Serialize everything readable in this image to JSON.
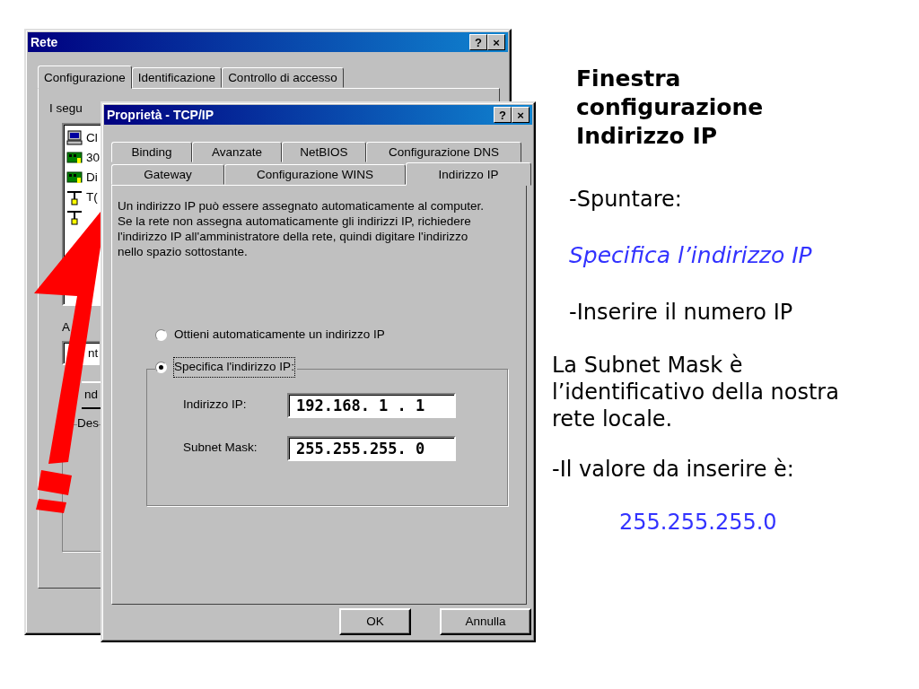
{
  "network_window": {
    "title": "Rete",
    "title_buttons": [
      "?",
      "×"
    ],
    "tabs": [
      {
        "label": "Configurazione",
        "selected": true
      },
      {
        "label": "Identificazione",
        "selected": false
      },
      {
        "label": "Controllo di accesso",
        "selected": false
      }
    ],
    "list_label": "I segu",
    "components": [
      {
        "kind": "client",
        "text": "Cl"
      },
      {
        "kind": "adapter",
        "text": "30"
      },
      {
        "kind": "adapter",
        "text": "Di"
      },
      {
        "kind": "protocol",
        "text": "T("
      },
      {
        "kind": "protocol"
      }
    ],
    "primary_label": "A",
    "primary_field": "nt",
    "button": "nd",
    "description_label": "Des"
  },
  "tcpip_window": {
    "title": "Proprietà - TCP/IP",
    "title_buttons": [
      "?",
      "×"
    ],
    "tab_rows": [
      [
        {
          "label": "Binding",
          "selected": false
        },
        {
          "label": "Avanzate",
          "selected": false
        },
        {
          "label": "NetBIOS",
          "selected": false
        },
        {
          "label": "Configurazione DNS",
          "selected": false
        }
      ],
      [
        {
          "label": "Gateway",
          "selected": false
        },
        {
          "label": "Configurazione WINS",
          "selected": false
        },
        {
          "label": "Indirizzo IP",
          "selected": true
        }
      ]
    ],
    "description": "Un indirizzo IP può essere assegnato automaticamente al computer. Se la rete non assegna automaticamente gli indirizzi IP, richiedere l'indirizzo IP all'amministratore della rete, quindi digitare l'indirizzo nello spazio sottostante.",
    "radios": [
      {
        "label": "Ottieni automaticamente un indirizzo IP",
        "selected": false
      },
      {
        "label": "Specifica l'indirizzo IP:",
        "selected": true
      }
    ],
    "fields": [
      {
        "label": "Indirizzo IP:",
        "value": "192.168. 1 . 1"
      },
      {
        "label": "Subnet Mask:",
        "value": "255.255.255. 0"
      }
    ],
    "buttons": [
      "OK",
      "Annulla"
    ]
  },
  "slide": {
    "heading": "Finestra configurazione Indirizzo IP",
    "notes": [
      {
        "kind": "step",
        "text": "-Spuntare:"
      },
      {
        "kind": "highlight",
        "text": "Specifica l’indirizzo IP"
      },
      {
        "kind": "step",
        "text": "-Inserire il numero IP"
      },
      {
        "kind": "paragraph",
        "text": "La Subnet Mask è l’identificativo della nostra rete locale."
      },
      {
        "kind": "paragraph",
        "text": "-Il valore da inserire è:"
      },
      {
        "kind": "value",
        "text": "255.255.255.0"
      }
    ]
  }
}
